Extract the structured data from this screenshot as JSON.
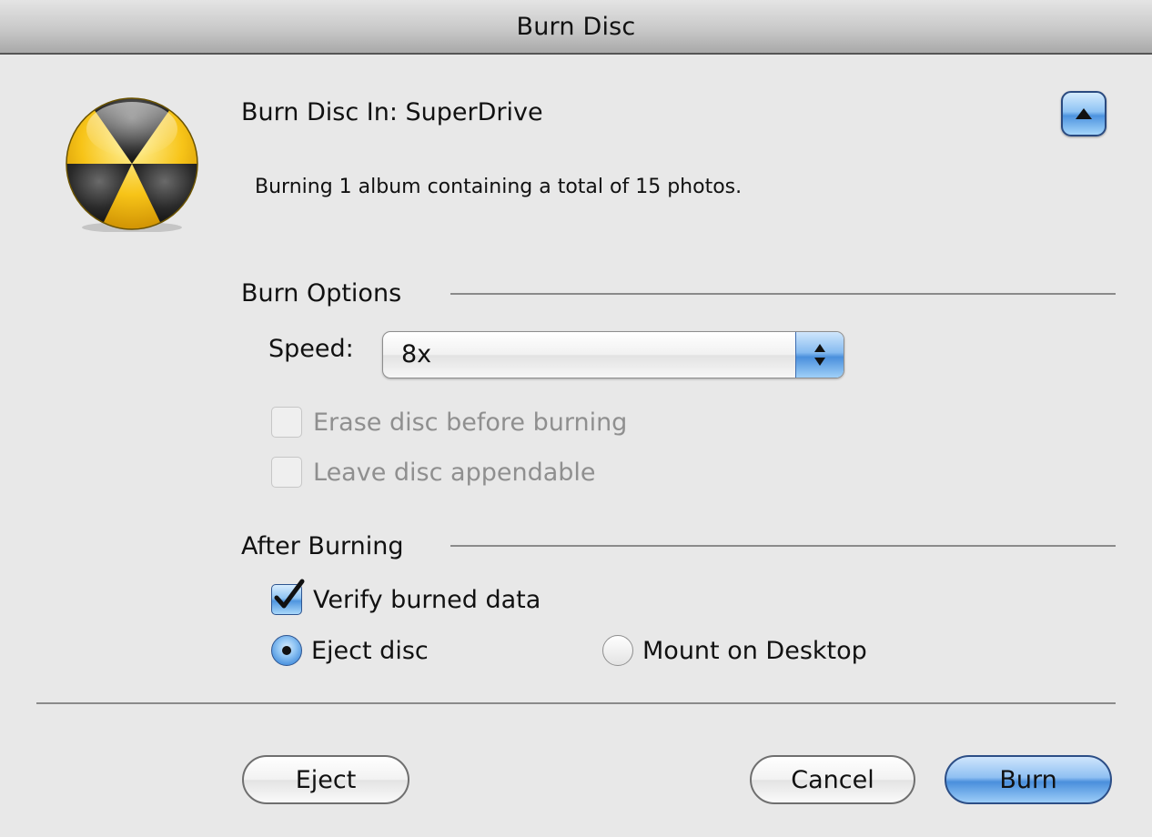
{
  "window": {
    "title": "Burn Disc"
  },
  "header": {
    "heading": "Burn Disc In:  SuperDrive",
    "summary": "Burning 1 album containing a total of 15 photos."
  },
  "burn_options": {
    "title": "Burn Options",
    "speed_label": "Speed:",
    "speed_value": "8x",
    "erase_label": "Erase disc before burning",
    "erase_checked": false,
    "erase_enabled": false,
    "appendable_label": "Leave disc appendable",
    "appendable_checked": false,
    "appendable_enabled": false
  },
  "after_burning": {
    "title": "After Burning",
    "verify_label": "Verify burned data",
    "verify_checked": true,
    "eject_label": "Eject disc",
    "mount_label": "Mount on Desktop",
    "selected": "Eject disc"
  },
  "buttons": {
    "eject": "Eject",
    "cancel": "Cancel",
    "burn": "Burn"
  },
  "colors": {
    "accent_blue": "#4a8fdc",
    "icon_yellow": "#f7c418",
    "icon_dark": "#2a2a2a"
  },
  "icons": {
    "app_icon": "burn-radiation-icon",
    "disclosure": "disclosure-up-triangle-icon",
    "select_arrows": "up-down-arrows-icon",
    "checkmark": "checkmark-icon"
  }
}
